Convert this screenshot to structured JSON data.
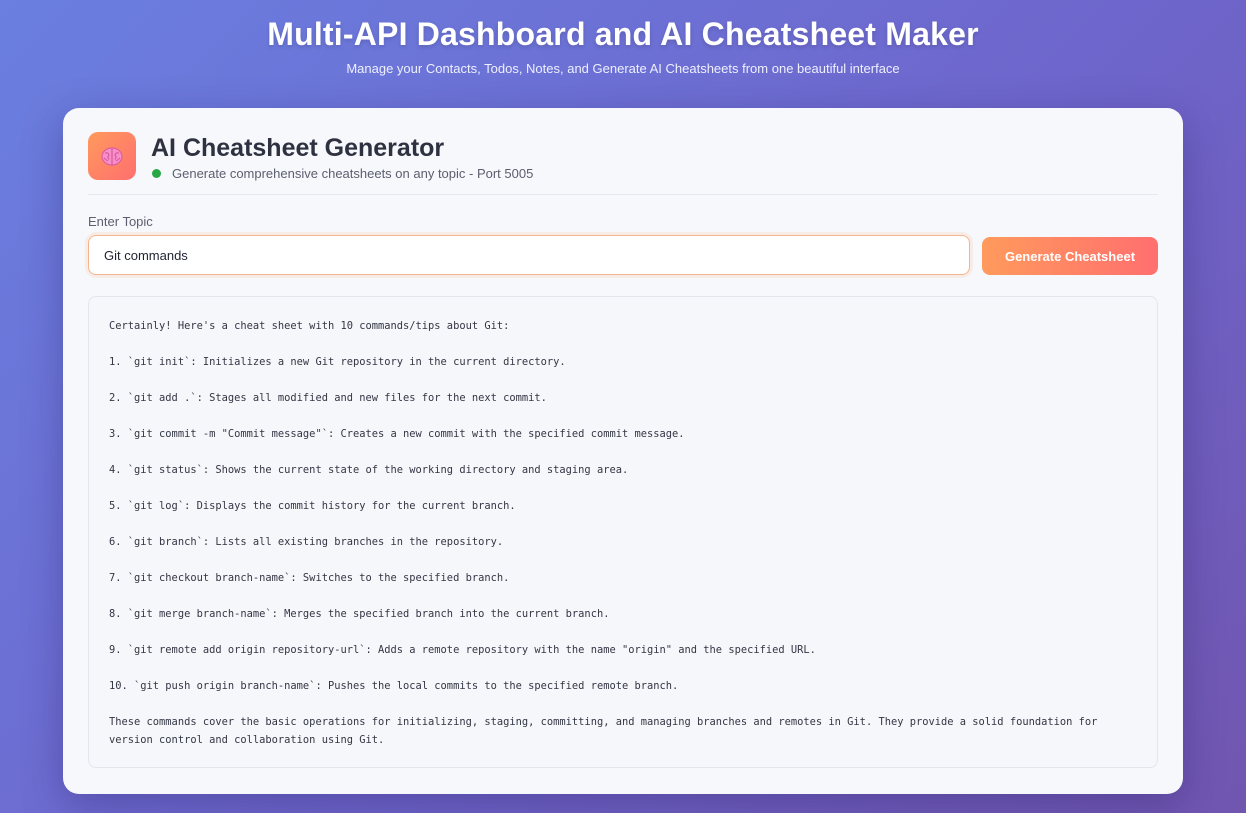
{
  "header": {
    "title": "Multi-API Dashboard and AI Cheatsheet Maker",
    "subtitle": "Manage your Contacts, Todos, Notes, and Generate AI Cheatsheets from one beautiful interface"
  },
  "card": {
    "icon": "brain-icon",
    "title": "AI Cheatsheet Generator",
    "status_text": "Generate comprehensive cheatsheets on any topic - Port 5005",
    "status_color": "#28a745"
  },
  "form": {
    "label": "Enter Topic",
    "topic_value": "Git commands",
    "button_label": "Generate Cheatsheet"
  },
  "output": {
    "lines": [
      "Certainly! Here's a cheat sheet with 10 commands/tips about Git:",
      "1. `git init`: Initializes a new Git repository in the current directory.",
      "2. `git add .`: Stages all modified and new files for the next commit.",
      "3. `git commit -m \"Commit message\"`: Creates a new commit with the specified commit message.",
      "4. `git status`: Shows the current state of the working directory and staging area.",
      "5. `git log`: Displays the commit history for the current branch.",
      "6. `git branch`: Lists all existing branches in the repository.",
      "7. `git checkout branch-name`: Switches to the specified branch.",
      "8. `git merge branch-name`: Merges the specified branch into the current branch.",
      "9. `git remote add origin repository-url`: Adds a remote repository with the name \"origin\" and the specified URL.",
      "10. `git push origin branch-name`: Pushes the local commits to the specified remote branch.",
      "These commands cover the basic operations for initializing, staging, committing, and managing branches and remotes in Git. They provide a solid foundation for version control and collaboration using Git."
    ]
  },
  "colors": {
    "accent_start": "#ff9a5c",
    "accent_end": "#ff6f6f",
    "background_start": "#6a7fe0",
    "background_end": "#7156b0"
  }
}
